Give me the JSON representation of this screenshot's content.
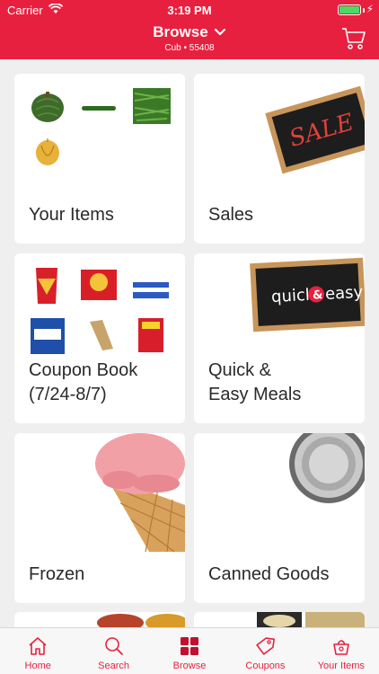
{
  "status": {
    "carrier": "Carrier",
    "time": "3:19 PM"
  },
  "header": {
    "title": "Browse",
    "subtitle": "Cub • 55408"
  },
  "cards": [
    {
      "label": "Your Items"
    },
    {
      "label": "Sales",
      "sign_text": "SALE"
    },
    {
      "label": "Coupon Book\n(7/24-8/7)"
    },
    {
      "label": "Quick &\nEasy Meals",
      "sign_text_a": "quick",
      "sign_text_b": "easy"
    },
    {
      "label": "Frozen"
    },
    {
      "label": "Canned Goods"
    }
  ],
  "tabs": [
    {
      "label": "Home",
      "icon": "home-icon"
    },
    {
      "label": "Search",
      "icon": "search-icon"
    },
    {
      "label": "Browse",
      "icon": "grid-icon"
    },
    {
      "label": "Coupons",
      "icon": "tag-icon"
    },
    {
      "label": "Your Items",
      "icon": "basket-icon"
    }
  ],
  "colors": {
    "brand": "#e8203f",
    "card_bg": "#ffffff",
    "page_bg": "#efefef"
  }
}
